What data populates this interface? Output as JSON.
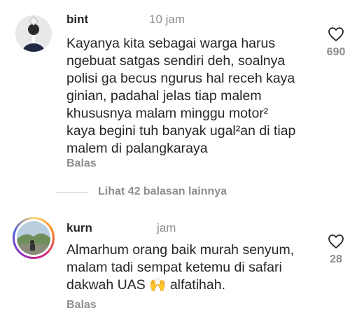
{
  "comments": [
    {
      "username": "bint",
      "time": "10 jam",
      "text_lines": [
        "Kayanya kita sebagai warga harus",
        "ngebuat satgas sendiri deh, soalnya",
        "polisi ga becus ngurus hal receh kaya",
        "ginian, padahal jelas tiap malem",
        "khususnya malam minggu motor²",
        "kaya begini tuh banyak ugal²an di tiap",
        "malem di palangkaraya"
      ],
      "likes": "690",
      "reply_label": "Balas"
    },
    {
      "username": "kurn",
      "time": "jam",
      "text_lines": [
        "Almarhum orang baik murah senyum,",
        "malam tadi sempat ketemu di safari",
        "dakwah UAS 🙌 alfatihah."
      ],
      "likes": "28",
      "reply_label": "Balas"
    }
  ],
  "view_replies": {
    "label": "Lihat 42 balasan lainnya"
  },
  "icons": {
    "like": "heart-outline-icon"
  },
  "colors": {
    "text": "#262626",
    "muted": "#8e8e8e",
    "ring_gradient": [
      "#feda75",
      "#fa7e1e",
      "#d62976",
      "#962fbf",
      "#4f5bd5"
    ]
  }
}
